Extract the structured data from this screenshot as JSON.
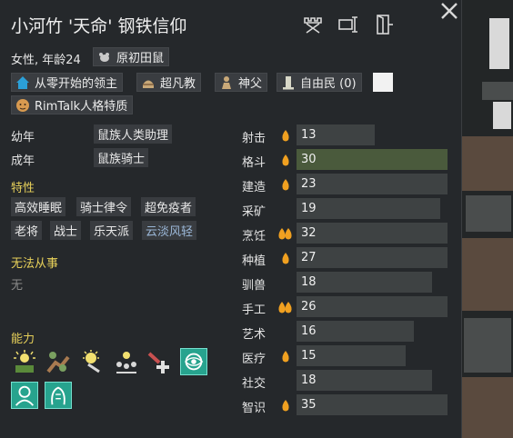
{
  "header": {
    "title": "小河竹 '天命' 钢铁信仰",
    "icons": [
      "crown-icon",
      "rename-icon",
      "banish-icon"
    ],
    "close_icon": "close-icon"
  },
  "identity": {
    "gender_age": "女性, 年龄24",
    "race": "原初田鼠"
  },
  "tags": [
    {
      "label": "从零开始的领主",
      "icon": "home-icon"
    },
    {
      "label": "超凡教",
      "icon": "ideology-icon"
    },
    {
      "label": "神父",
      "icon": "priest-icon"
    },
    {
      "label": "自由民 (0)",
      "icon": "pillar-icon"
    },
    {
      "label": "RimTalk人格特质",
      "icon": "face-icon"
    }
  ],
  "backstory": {
    "childhood_label": "幼年",
    "childhood_value": "鼠族人类助理",
    "adulthood_label": "成年",
    "adulthood_value": "鼠族骑士"
  },
  "traits": {
    "title": "特性",
    "items": [
      "高效睡眠",
      "骑士律令",
      "超免疫者",
      "老将",
      "战士",
      "乐天派",
      "云淡风轻"
    ]
  },
  "incapable": {
    "title": "无法从事",
    "value": "无"
  },
  "abilities": {
    "title": "能力",
    "icons": [
      "inspire-icon",
      "fertilize-icon",
      "enlighten-icon",
      "rally-icon",
      "heal-icon",
      "psycast-icon",
      "mindshield-icon",
      "dreamer-icon"
    ]
  },
  "skills": [
    {
      "name": "射击",
      "value": 13,
      "passion": 1,
      "level": 0.52
    },
    {
      "name": "格斗",
      "value": 30,
      "passion": 1,
      "level": 1.0
    },
    {
      "name": "建造",
      "value": 23,
      "passion": 1,
      "level": 1.0
    },
    {
      "name": "采矿",
      "value": 19,
      "passion": 0,
      "level": 0.95
    },
    {
      "name": "烹饪",
      "value": 32,
      "passion": 2,
      "level": 1.0
    },
    {
      "name": "种植",
      "value": 27,
      "passion": 1,
      "level": 1.0
    },
    {
      "name": "驯兽",
      "value": 18,
      "passion": 0,
      "level": 0.9
    },
    {
      "name": "手工",
      "value": 26,
      "passion": 2,
      "level": 1.0
    },
    {
      "name": "艺术",
      "value": 16,
      "passion": 0,
      "level": 0.78
    },
    {
      "name": "医疗",
      "value": 15,
      "passion": 1,
      "level": 0.72
    },
    {
      "name": "社交",
      "value": 18,
      "passion": 0,
      "level": 0.9
    },
    {
      "name": "智识",
      "value": 35,
      "passion": 1,
      "level": 1.0
    }
  ],
  "colors": {
    "panel_bg": "#25282b",
    "section_title": "#e8d15a",
    "bar": "#3e4243",
    "bar_highlight": "#4a5a3c",
    "passion_flame": "#f0a020",
    "ability_teal": "#27a38e"
  }
}
